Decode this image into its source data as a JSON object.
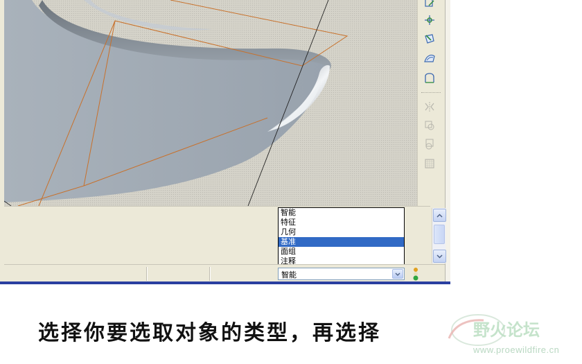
{
  "selection_filter": {
    "options": [
      "智能",
      "特征",
      "几何",
      "基准",
      "面组",
      "注释"
    ],
    "highlighted": "基准",
    "current_value": "智能"
  },
  "right_toolbar": {
    "icons": [
      "datum-axis-icon",
      "datum-point-icon",
      "datum-coordsys-icon",
      "datum-curve-icon",
      "sketch-icon",
      "mirror-icon",
      "merge-icon",
      "trim-icon",
      "pattern-icon"
    ]
  },
  "caption": {
    "text": "选择你要选取对象的类型，再选择"
  },
  "watermark": {
    "logo_text": "野火论坛",
    "url": "www.proewildfire.cn"
  },
  "colors": {
    "selection_highlight": "#316ac5",
    "part_surface": "#a3adb6",
    "datum_plane": "#c8702a",
    "bottom_border": "#2a3fa0"
  }
}
